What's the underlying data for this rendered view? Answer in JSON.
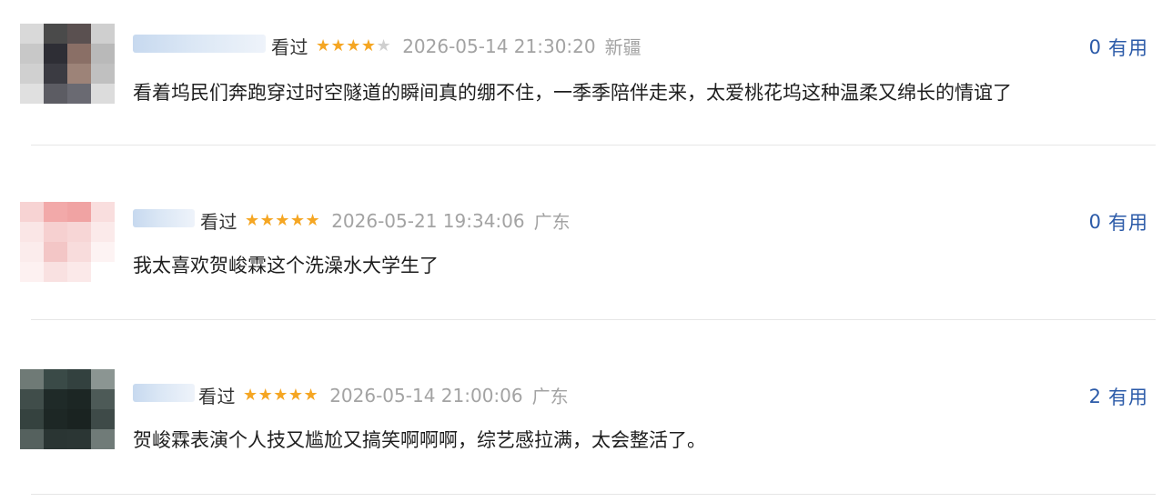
{
  "comments": [
    {
      "watched": "看过",
      "rating_stars": 4,
      "stars_on": "★★★★",
      "stars_off": "★",
      "date": "2026-05-14 21:30:20",
      "location": "新疆",
      "useful_count": "0",
      "useful_label": "有用",
      "text": "看着坞民们奔跑穿过时空隧道的瞬间真的绷不住，一季季陪伴走来，太爱桃花坞这种温柔又绵长的情谊了"
    },
    {
      "watched": "看过",
      "rating_stars": 5,
      "stars_on": "★★★★★",
      "stars_off": "",
      "date": "2026-05-21 19:34:06",
      "location": "广东",
      "useful_count": "0",
      "useful_label": "有用",
      "text": "我太喜欢贺峻霖这个洗澡水大学生了"
    },
    {
      "watched": "看过",
      "rating_stars": 5,
      "stars_on": "★★★★★",
      "stars_off": "",
      "date": "2026-05-14 21:00:06",
      "location": "广东",
      "useful_count": "2",
      "useful_label": "有用",
      "text": "贺峻霖表演个人技又尴尬又搞笑啊啊啊，综艺感拉满，太会整活了。"
    }
  ],
  "colors": {
    "star": "#f5a623",
    "useful": "#2b5aa8",
    "meta": "#a3a3a3"
  }
}
